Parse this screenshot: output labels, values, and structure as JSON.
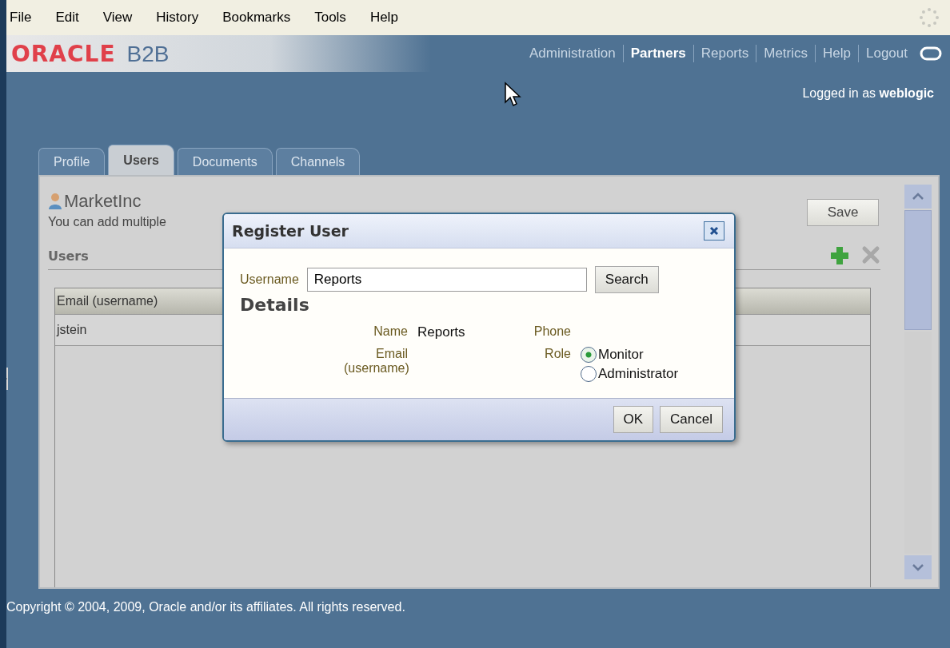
{
  "menu": [
    "File",
    "Edit",
    "View",
    "History",
    "Bookmarks",
    "Tools",
    "Help"
  ],
  "header": {
    "logo": "ORACLE",
    "product": "B2B",
    "nav": [
      {
        "label": "Administration",
        "selected": false
      },
      {
        "label": "Partners",
        "selected": true
      },
      {
        "label": "Reports",
        "selected": false
      },
      {
        "label": "Metrics",
        "selected": false
      },
      {
        "label": "Help",
        "selected": false
      },
      {
        "label": "Logout",
        "selected": false
      }
    ],
    "logged_in": "Logged in as **weblogic**"
  },
  "tabs": [
    {
      "label": "Profile",
      "selected": false
    },
    {
      "label": "Users",
      "selected": true
    },
    {
      "label": "Documents",
      "selected": false
    },
    {
      "label": "Channels",
      "selected": false
    }
  ],
  "partner": {
    "name": "MarketInc",
    "description": "You can add multiple",
    "save": "Save",
    "section": "Users",
    "table": {
      "columns": [
        "Email (username)"
      ],
      "rows": [
        [
          "jstein"
        ]
      ]
    }
  },
  "dialog": {
    "title": "Register User",
    "username_label": "Username",
    "username_value": "Reports",
    "search": "Search",
    "details_title": "Details",
    "name_label": "Name",
    "name_value": "Reports",
    "email_label": "Email (username)",
    "phone_label": "Phone",
    "role_label": "Role",
    "roles": [
      {
        "label": "Monitor",
        "selected": true
      },
      {
        "label": "Administrator",
        "selected": false
      }
    ],
    "buttons": [
      "OK",
      "Cancel"
    ]
  },
  "footer": "Copyright © 2004, 2009, Oracle and/or its affiliates. All rights reserved."
}
